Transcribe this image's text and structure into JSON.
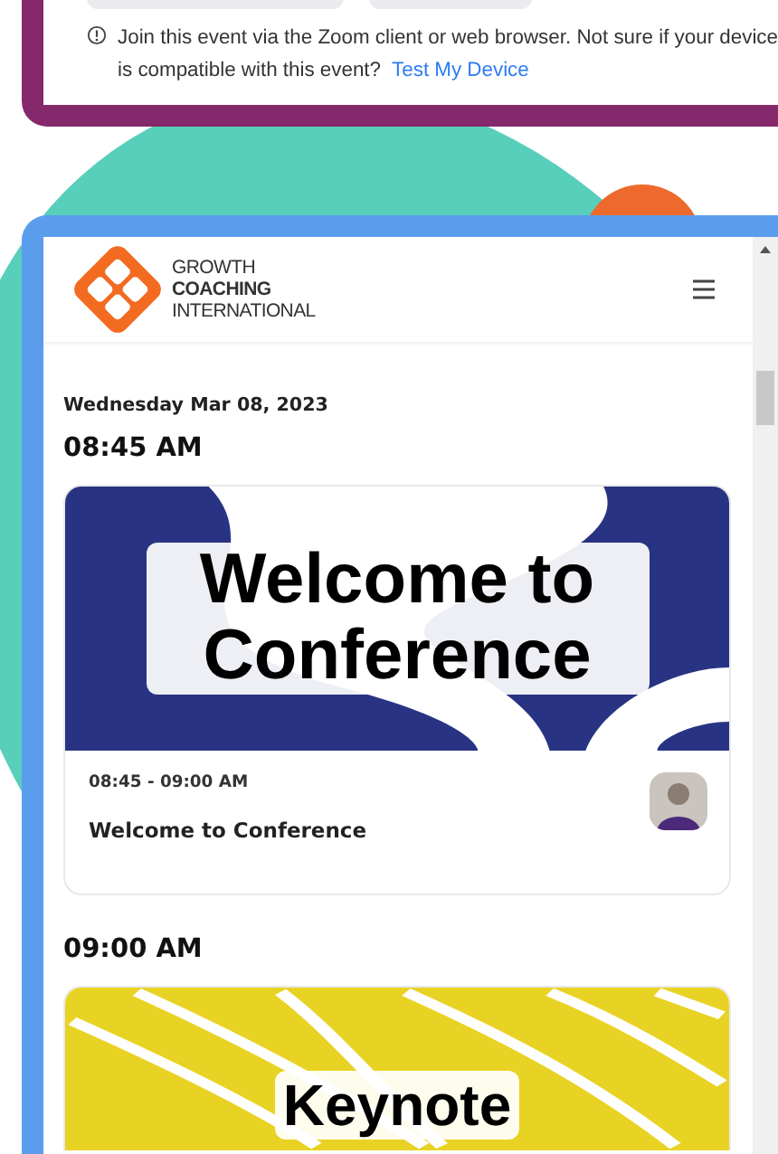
{
  "join_panel": {
    "notice": "Join this event via the Zoom client or web browser. Not sure if your device is compatible with this event?",
    "link": "Test My Device"
  },
  "app": {
    "logo": [
      "GROWTH",
      "COACHING",
      "INTERNATIONAL"
    ],
    "date": "Wednesday Mar 08, 2023",
    "slots": [
      {
        "time": "08:45 AM",
        "banner": {
          "text": "Welcome to Conference",
          "color": "#283483",
          "kind": "waves"
        },
        "session": {
          "range": "08:45 - 09:00 AM",
          "title": "Welcome to Conference"
        }
      },
      {
        "time": "09:00 AM",
        "banner": {
          "text": "Keynote",
          "color": "#e8d324",
          "kind": "stripes"
        }
      }
    ]
  }
}
